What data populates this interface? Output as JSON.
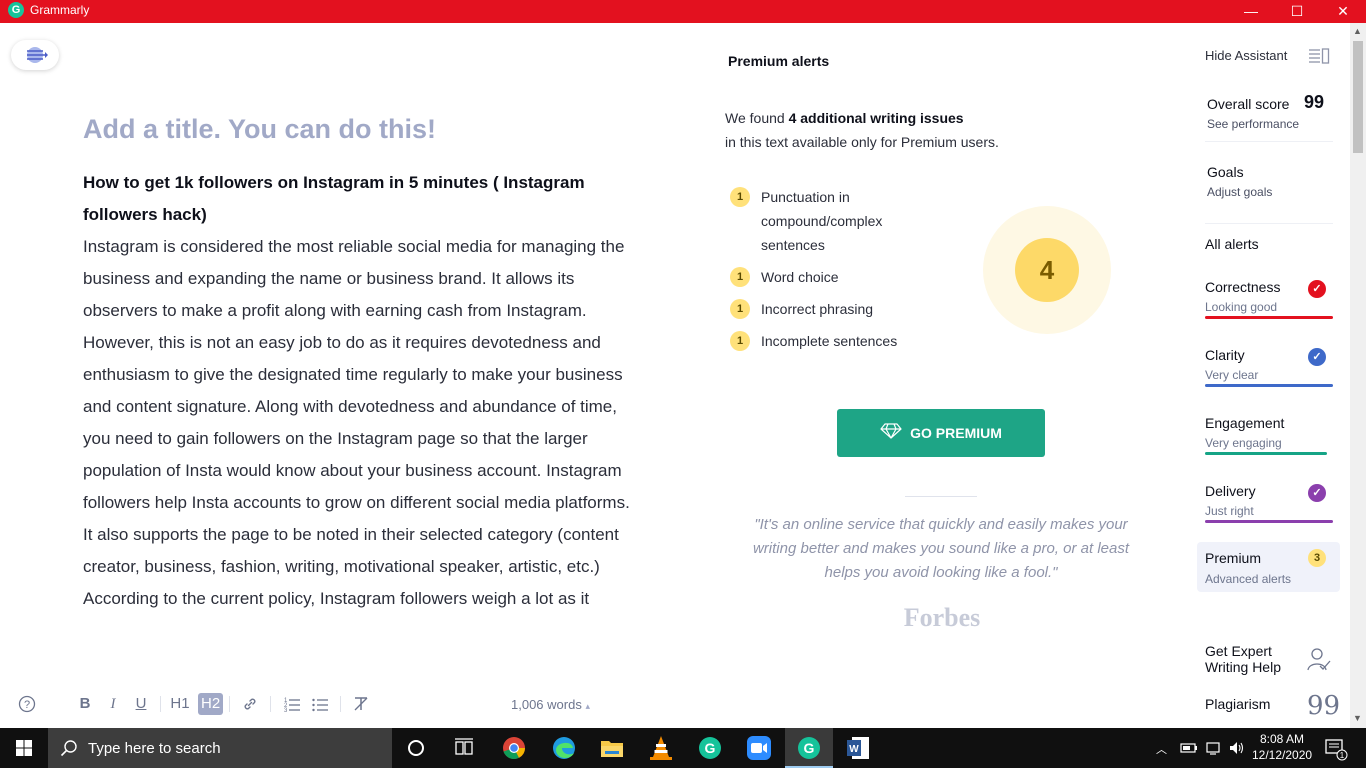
{
  "window": {
    "title": "Grammarly",
    "logo_letter": "G",
    "minimize": "—",
    "maximize": "☐",
    "close": "✕"
  },
  "editor": {
    "title_placeholder": "Add a title. You can do this!",
    "heading": "How to get 1k followers on Instagram in 5 minutes ( Instagram followers hack)",
    "paragraph1": "Instagram is considered the most reliable social media for managing the business and expanding the name or business brand. It allows its observers to make a profit along with earning cash from Instagram. However, this is not an easy job to do as it requires devotedness and enthusiasm to give the designated time regularly to make your business and content signature. Along with devotedness and abundance of time, you need to gain followers on the Instagram page so that the larger population of Insta would know about your business account. Instagram followers help Insta accounts to grow on different social media platforms. It also supports the page to be noted in their selected category (content creator, business, fashion, writing, motivational speaker, artistic, etc.)",
    "paragraph2": "According to the current policy, Instagram followers weigh a lot as it",
    "toolbar": {
      "help": "?",
      "bold": "B",
      "italic": "I",
      "underline": "U",
      "h1": "H1",
      "h2": "H2",
      "link": "⚭",
      "ordered_list": "⒈",
      "bullet_list": "☰",
      "clear": "T̶"
    },
    "word_count": "1,006 words",
    "word_count_caret": "▴"
  },
  "premium_panel": {
    "heading": "Premium alerts",
    "found_prefix": "We found ",
    "found_bold": "4 additional writing issues",
    "found_suffix": "in this text available only for Premium users.",
    "issues": [
      {
        "count": "1",
        "label": "Punctuation in compound/complex sentences"
      },
      {
        "count": "1",
        "label": "Word choice"
      },
      {
        "count": "1",
        "label": "Incorrect phrasing"
      },
      {
        "count": "1",
        "label": "Incomplete sentences"
      }
    ],
    "total": "4",
    "cta": "GO PREMIUM",
    "quote": "\"It's an online service that quickly and easily makes your writing better and makes you sound like a pro, or at least helps you avoid looking like a fool.\"",
    "quote_source": "Forbes"
  },
  "sidebar": {
    "hide_assistant": "Hide Assistant",
    "overall_score_label": "Overall score",
    "overall_score": "99",
    "see_performance": "See performance",
    "goals": "Goals",
    "adjust_goals": "Adjust goals",
    "all_alerts": "All alerts",
    "categories": [
      {
        "name": "Correctness",
        "status": "Looking good",
        "color": "#e3111f"
      },
      {
        "name": "Clarity",
        "status": "Very clear",
        "color": "#3e69c9"
      },
      {
        "name": "Engagement",
        "status": "Very engaging",
        "color": "#15a486"
      },
      {
        "name": "Delivery",
        "status": "Just right",
        "color": "#8b3fad"
      }
    ],
    "premium": {
      "name": "Premium",
      "status": "Advanced alerts",
      "count": "3"
    },
    "expert_help": "Get Expert Writing Help",
    "plagiarism": "Plagiarism",
    "plagiarism_glyph": "99"
  },
  "taskbar": {
    "search_placeholder": "Type here to search",
    "time": "8:08 AM",
    "date": "12/12/2020",
    "notification_count": "1"
  },
  "colors": {
    "titlebar": "#e3111f",
    "premium_green": "#1ea586",
    "alert_yellow": "#ffe17a"
  }
}
